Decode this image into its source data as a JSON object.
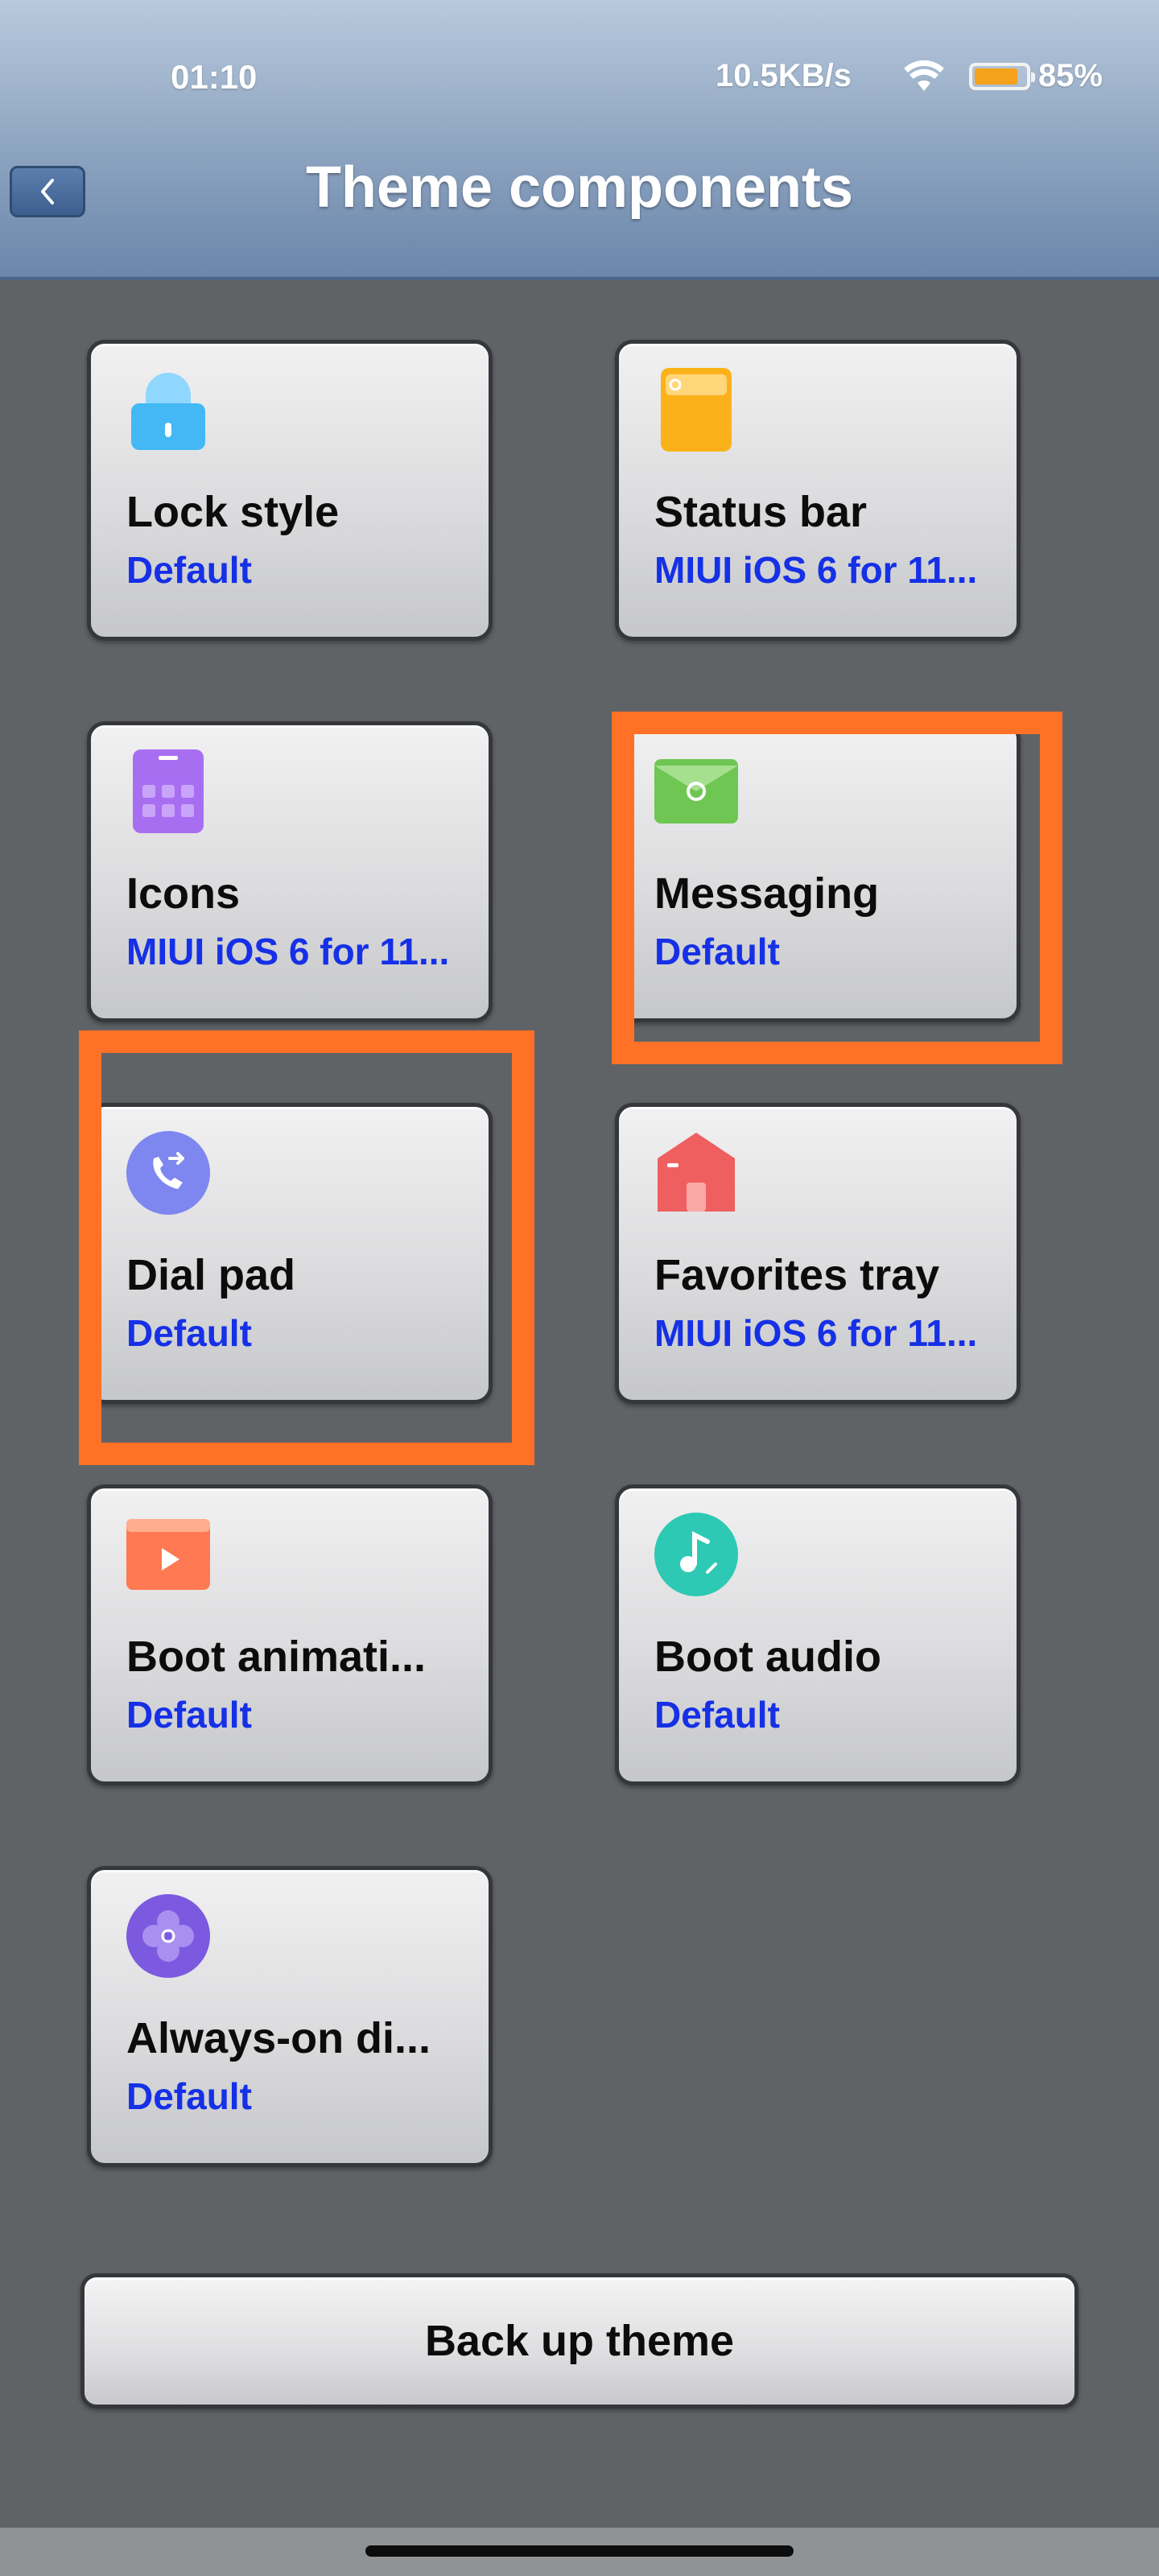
{
  "status_bar": {
    "time": "01:10",
    "network_speed": "10.5KB/s",
    "battery_percent": "85%",
    "battery_level": 0.85
  },
  "header": {
    "title": "Theme components",
    "back_icon": "chevron-left-icon"
  },
  "components": [
    {
      "name": "Lock style",
      "value": "Default",
      "icon": "lock-icon",
      "color": "#43b8f5"
    },
    {
      "name": "Status bar",
      "value": "MIUI iOS 6 for 11...",
      "icon": "status-bar-icon",
      "color": "#fbb21a"
    },
    {
      "name": "Icons",
      "value": "MIUI iOS 6 for 11...",
      "icon": "grid-icon",
      "color": "#a86ef2"
    },
    {
      "name": "Messaging",
      "value": "Default",
      "icon": "envelope-icon",
      "color": "#6fc653"
    },
    {
      "name": "Dial pad",
      "value": "Default",
      "icon": "phone-icon",
      "color": "#7e86ef"
    },
    {
      "name": "Favorites tray",
      "value": "MIUI iOS 6 for 11...",
      "icon": "home-icon",
      "color": "#ef5f5f"
    },
    {
      "name": "Boot animati...",
      "value": "Default",
      "icon": "play-icon",
      "color": "#ff7a52"
    },
    {
      "name": "Boot audio",
      "value": "Default",
      "icon": "music-note-icon",
      "color": "#2dc9b4"
    },
    {
      "name": "Always-on di...",
      "value": "Default",
      "icon": "flower-icon",
      "color": "#7b5ae0"
    }
  ],
  "backup_button": {
    "label": "Back up theme"
  },
  "colors": {
    "highlight": "#ff7126",
    "value_text": "#1530e6",
    "background": "#606366"
  }
}
